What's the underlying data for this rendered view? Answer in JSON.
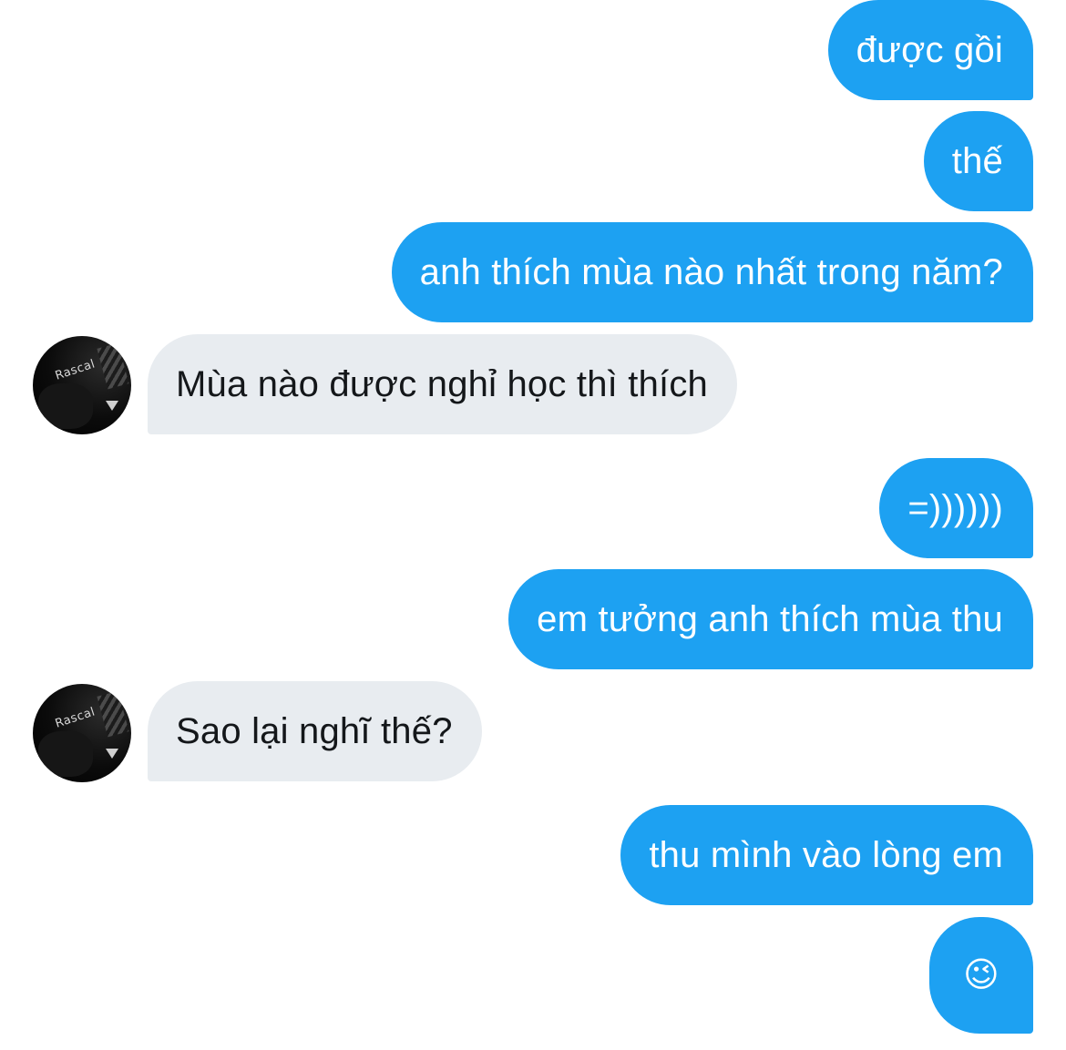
{
  "conversation": {
    "messages": [
      {
        "direction": "outgoing",
        "text": "được gồi"
      },
      {
        "direction": "outgoing",
        "text": "thế"
      },
      {
        "direction": "outgoing",
        "text": "anh thích mùa nào nhất trong năm?"
      },
      {
        "direction": "incoming",
        "text": "Mùa nào được nghỉ học thì thích"
      },
      {
        "direction": "outgoing",
        "text": "=))))))"
      },
      {
        "direction": "outgoing",
        "text": "em tưởng anh thích mùa thu"
      },
      {
        "direction": "incoming",
        "text": "Sao lại nghĩ thế?"
      },
      {
        "direction": "outgoing",
        "text": "thu mình vào lòng em"
      },
      {
        "direction": "outgoing",
        "text": "😉"
      }
    ]
  },
  "avatar": {
    "logo_text": "Rascal"
  },
  "colors": {
    "outgoing_bubble": "#1da1f2",
    "incoming_bubble": "#e8ecf0",
    "outgoing_text": "#ffffff",
    "incoming_text": "#14171a"
  }
}
